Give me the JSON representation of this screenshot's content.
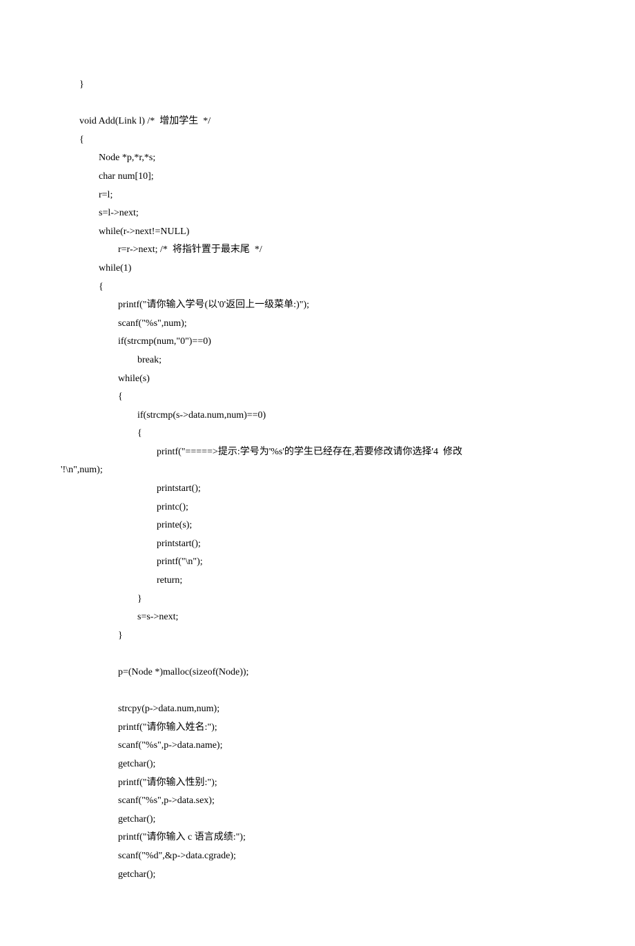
{
  "code": {
    "lines": [
      "}",
      "",
      "void Add(Link l) /*  增加学生  */",
      "{",
      "        Node *p,*r,*s;",
      "        char num[10];",
      "        r=l;",
      "        s=l->next;",
      "        while(r->next!=NULL)",
      "                r=r->next; /*  将指针置于最末尾  */",
      "        while(1)",
      "        {",
      "                printf(\"请你输入学号(以'0'返回上一级菜单:)\");",
      "                scanf(\"%s\",num);",
      "                if(strcmp(num,\"0\")==0)",
      "                        break;",
      "                while(s)",
      "                {",
      "                        if(strcmp(s->data.num,num)==0)",
      "                        {",
      "                                printf(\"=====>提示:学号为'%s'的学生已经存在,若要修改请你选择'4  修改",
      "'!\\n\",num);",
      "                                printstart();",
      "                                printc();",
      "                                printe(s);",
      "                                printstart();",
      "                                printf(\"\\n\");",
      "                                return;",
      "                        }",
      "                        s=s->next;",
      "                }",
      "",
      "                p=(Node *)malloc(sizeof(Node));",
      "",
      "                strcpy(p->data.num,num);",
      "                printf(\"请你输入姓名:\");",
      "                scanf(\"%s\",p->data.name);",
      "                getchar();",
      "                printf(\"请你输入性别:\");",
      "                scanf(\"%s\",p->data.sex);",
      "                getchar();",
      "                printf(\"请你输入 c 语言成绩:\");",
      "                scanf(\"%d\",&p->data.cgrade);",
      "                getchar();"
    ],
    "wrapped_line_index": 21
  }
}
